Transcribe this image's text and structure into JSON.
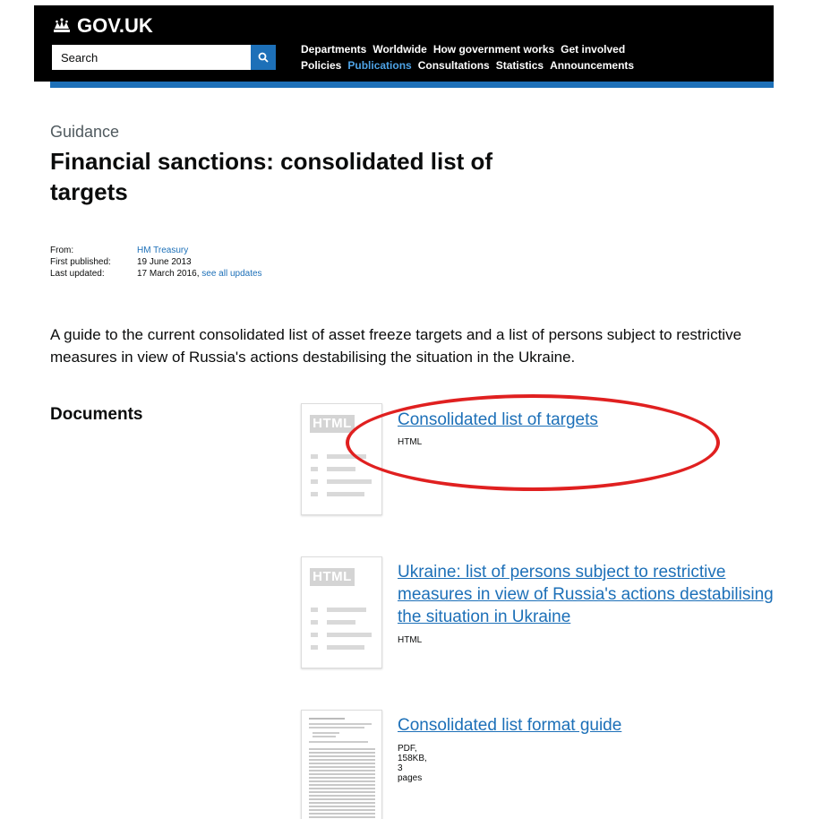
{
  "header": {
    "logo_text": "GOV.UK",
    "search_placeholder": "Search",
    "nav_row1": [
      "Departments",
      "Worldwide",
      "How government works",
      "Get involved"
    ],
    "nav_row2": [
      "Policies",
      "Publications",
      "Consultations",
      "Statistics",
      "Announcements"
    ],
    "active_nav": "Publications"
  },
  "page": {
    "type_label": "Guidance",
    "title": "Financial sanctions: consolidated list of targets",
    "meta": {
      "from_label": "From:",
      "from_value": "HM Treasury",
      "published_label": "First published:",
      "published_value": "19 June 2013",
      "updated_label": "Last updated:",
      "updated_value": "17 March 2016,",
      "updated_link": "see all updates"
    },
    "summary": "A guide to the current consolidated list of asset freeze targets and a list of persons subject to restrictive measures in view of Russia's actions destabilising the situation in the Ukraine.",
    "documents_heading": "Documents"
  },
  "documents": [
    {
      "title": "Consolidated list of targets",
      "meta": "HTML",
      "thumb_label": "HTML"
    },
    {
      "title": "Ukraine: list of persons subject to restrictive measures in view of Russia's actions destabilising the situation in Ukraine",
      "meta": "HTML",
      "thumb_label": "HTML"
    },
    {
      "title": "Consolidated list format guide",
      "meta": "PDF, 158KB, 3 pages",
      "thumb_label": ""
    }
  ],
  "colors": {
    "header_bg": "#000000",
    "accent_blue": "#1d70b8",
    "highlight_ellipse": "#e02020"
  }
}
